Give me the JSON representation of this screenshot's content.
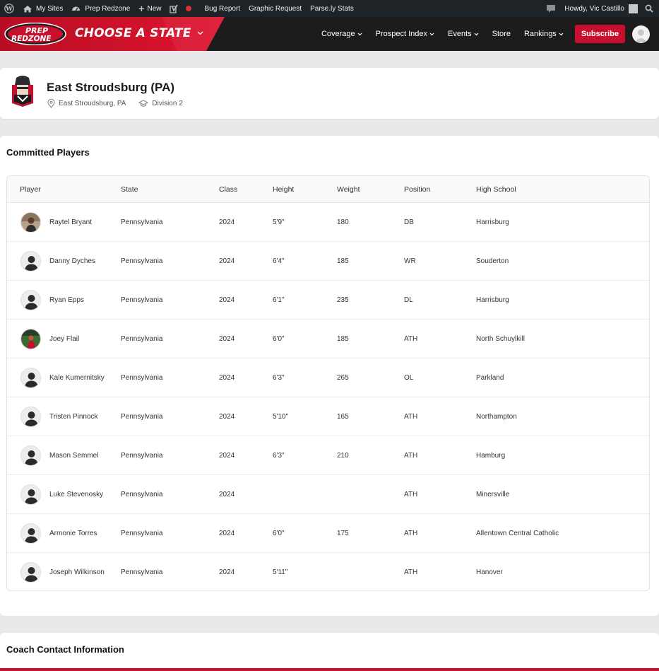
{
  "adminbar": {
    "my_sites": "My Sites",
    "site_name": "Prep Redzone",
    "new_label": "New",
    "bug_report": "Bug Report",
    "graphic_request": "Graphic Request",
    "parsely": "Parse.ly Stats",
    "howdy": "Howdy, Vic Castillo"
  },
  "nav": {
    "logo_top": "PREP",
    "logo_bottom": "REDZONE",
    "choose_state": "CHOOSE A STATE",
    "links": [
      "Coverage",
      "Prospect Index",
      "Events",
      "Store",
      "Rankings"
    ],
    "subscribe": "Subscribe",
    "accent_color": "#c8102e"
  },
  "school": {
    "name": "East Stroudsburg (PA)",
    "location": "East Stroudsburg, PA",
    "division": "Division 2"
  },
  "players_section": {
    "title": "Committed Players",
    "columns": [
      "Player",
      "State",
      "Class",
      "Height",
      "Weight",
      "Position",
      "High School"
    ],
    "rows": [
      {
        "name": "Raytel Bryant",
        "state": "Pennsylvania",
        "class": "2024",
        "height": "5'9\"",
        "weight": "180",
        "position": "DB",
        "high_school": "Harrisburg",
        "photo": "photo"
      },
      {
        "name": "Danny Dyches",
        "state": "Pennsylvania",
        "class": "2024",
        "height": "6'4\"",
        "weight": "185",
        "position": "WR",
        "high_school": "Souderton",
        "photo": "placeholder"
      },
      {
        "name": "Ryan Epps",
        "state": "Pennsylvania",
        "class": "2024",
        "height": "6'1\"",
        "weight": "235",
        "position": "DL",
        "high_school": "Harrisburg",
        "photo": "placeholder"
      },
      {
        "name": "Joey Flail",
        "state": "Pennsylvania",
        "class": "2024",
        "height": "6'0\"",
        "weight": "185",
        "position": "ATH",
        "high_school": "North Schuylkill",
        "photo": "photo-field"
      },
      {
        "name": "Kale Kumernitsky",
        "state": "Pennsylvania",
        "class": "2024",
        "height": "6'3\"",
        "weight": "265",
        "position": "OL",
        "high_school": "Parkland",
        "photo": "placeholder"
      },
      {
        "name": "Tristen Pinnock",
        "state": "Pennsylvania",
        "class": "2024",
        "height": "5'10\"",
        "weight": "165",
        "position": "ATH",
        "high_school": "Northampton",
        "photo": "placeholder"
      },
      {
        "name": "Mason Semmel",
        "state": "Pennsylvania",
        "class": "2024",
        "height": "6'3\"",
        "weight": "210",
        "position": "ATH",
        "high_school": "Hamburg",
        "photo": "placeholder"
      },
      {
        "name": "Luke Stevenosky",
        "state": "Pennsylvania",
        "class": "2024",
        "height": "",
        "weight": "",
        "position": "ATH",
        "high_school": "Minersville",
        "photo": "placeholder"
      },
      {
        "name": "Armonie Torres",
        "state": "Pennsylvania",
        "class": "2024",
        "height": "6'0\"",
        "weight": "175",
        "position": "ATH",
        "high_school": "Allentown Central Catholic",
        "photo": "placeholder"
      },
      {
        "name": "Joseph Wilkinson",
        "state": "Pennsylvania",
        "class": "2024",
        "height": "5'11\"",
        "weight": "",
        "position": "ATH",
        "high_school": "Hanover",
        "photo": "placeholder"
      }
    ]
  },
  "coach_section": {
    "title": "Coach Contact Information"
  }
}
